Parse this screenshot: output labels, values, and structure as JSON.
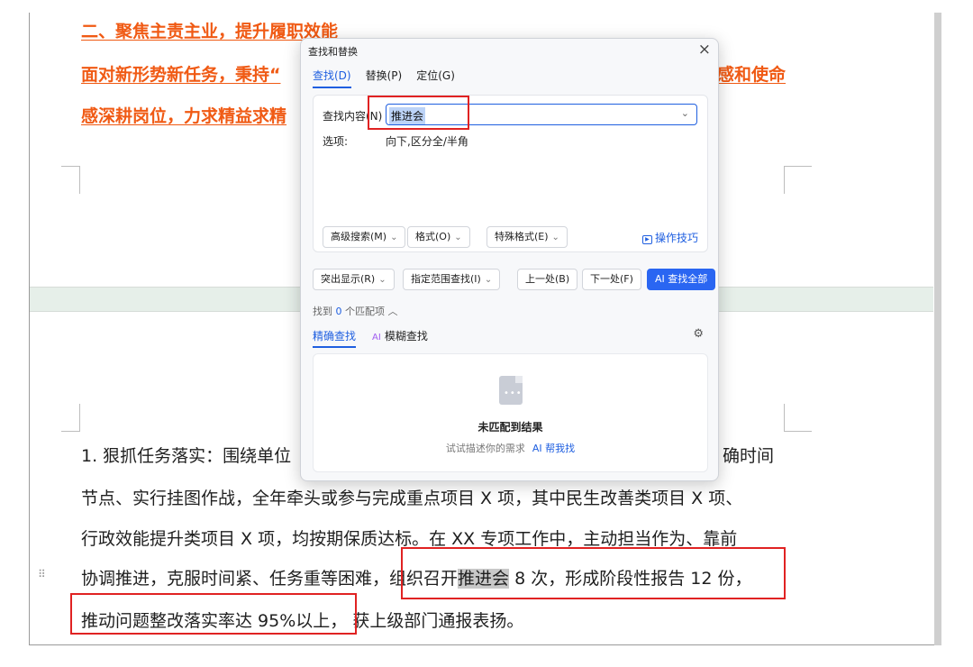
{
  "document": {
    "heading1": "二、聚焦主责主业，提升履职效能",
    "heading2_left": "面对新形势新任务，秉持“",
    "heading2_right": "感和使命",
    "heading3_left": "感深耕岗位，力求精益求精",
    "para_line1_left": "1. 狠抓任务落实：围绕单位",
    "para_line1_right": "确时间",
    "para_line2": "节点、实行挂图作战，全年牵头或参与完成重点项目 X 项，其中民生改善类项目 X 项、",
    "para_line3": "行政效能提升类项目 X 项，均按期保质达标。在 XX 专项工作中，主动担当作为、靠前",
    "para_line4_a": "协调推进，克服时间紧、任务重等困难，",
    "para_line4_b": "组织召开",
    "para_line4_hl": "推进会",
    "para_line4_c": " 8 次，形成阶段性报告 12 份，",
    "para_line5_a": "推动问题整改落实率达 95%以上，",
    "para_line5_b": " 获上级部门通报表扬。"
  },
  "dialog": {
    "title": "查找和替换",
    "tabs": [
      "查找(D)",
      "替换(P)",
      "定位(G)"
    ],
    "find_label": "查找内容(N)",
    "find_value": "推进会",
    "options_label": "选项:",
    "options_value": "向下,区分全/半角",
    "advanced_search": "高级搜索(M)",
    "format": "格式(O)",
    "special_format": "特殊格式(E)",
    "tips": "操作技巧",
    "highlight": "突出显示(R)",
    "range_find": "指定范围查找(I)",
    "prev": "上一处(B)",
    "next": "下一处(F)",
    "find_all": "AI 查找全部",
    "found_prefix": "找到",
    "found_count": "0",
    "found_suffix": "个匹配项",
    "mode_exact": "精确查找",
    "mode_fuzzy_badge": "AI",
    "mode_fuzzy": "模糊查找",
    "empty_title": "未匹配到结果",
    "empty_desc": "试试描述你的需求",
    "ai_help": "AI 帮我找"
  },
  "colors": {
    "accent": "#1f5fe0",
    "heading": "#f05a14",
    "annotation": "#e02222"
  }
}
